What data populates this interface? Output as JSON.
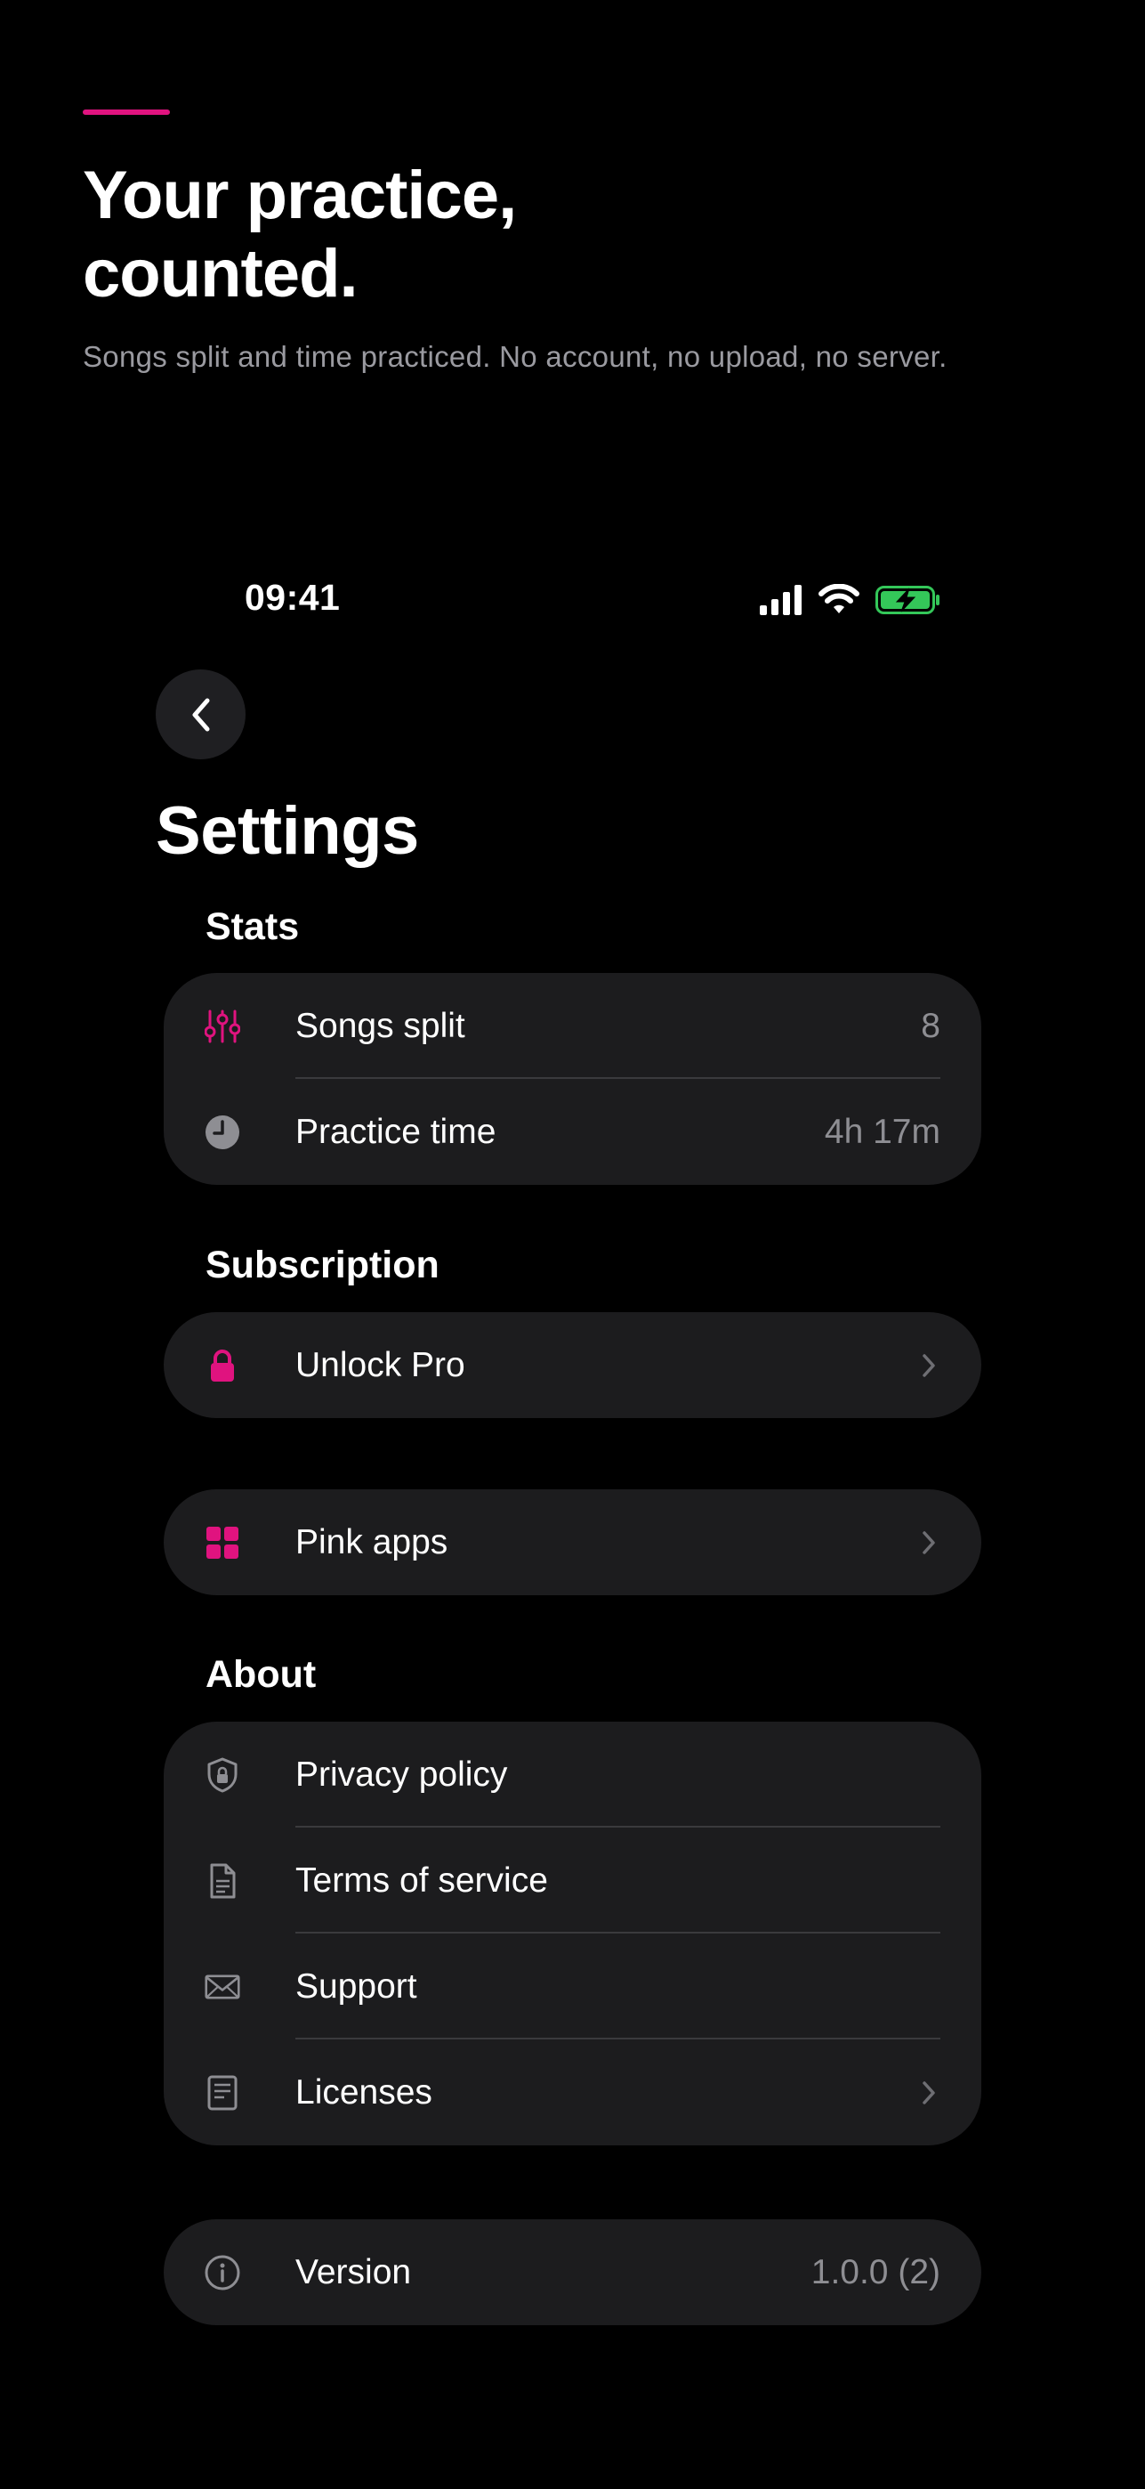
{
  "hero": {
    "headline_line1": "Your practice,",
    "headline_line2": "counted.",
    "subhead": "Songs split and time practiced. No account, no upload, no server.",
    "accent_color": "#e0137f"
  },
  "status_bar": {
    "time": "09:41",
    "icons": [
      "cellular-signal-icon",
      "wifi-icon",
      "battery-charging-icon"
    ]
  },
  "nav": {
    "back_icon": "chevron-left-icon",
    "title": "Settings"
  },
  "stats": {
    "header": "Stats",
    "rows": [
      {
        "icon": "sliders-icon",
        "label": "Songs split",
        "value": "8"
      },
      {
        "icon": "clock-icon",
        "label": "Practice time",
        "value": "4h 17m"
      }
    ]
  },
  "subscription": {
    "header": "Subscription",
    "rows": [
      {
        "icon": "lock-icon",
        "label": "Unlock Pro"
      }
    ]
  },
  "apps": {
    "rows": [
      {
        "icon": "grid-icon",
        "label": "Pink apps"
      }
    ]
  },
  "about": {
    "header": "About",
    "rows": [
      {
        "icon": "shield-lock-icon",
        "label": "Privacy policy"
      },
      {
        "icon": "document-icon",
        "label": "Terms of service"
      },
      {
        "icon": "envelope-icon",
        "label": "Support"
      },
      {
        "icon": "notes-icon",
        "label": "Licenses"
      }
    ]
  },
  "version": {
    "icon": "info-icon",
    "label": "Version",
    "value": "1.0.0 (2)"
  },
  "colors": {
    "background": "#000000",
    "card": "#1c1c1e",
    "accent": "#e0137f",
    "secondary_text": "#8e8e93",
    "battery_green": "#34c759"
  }
}
